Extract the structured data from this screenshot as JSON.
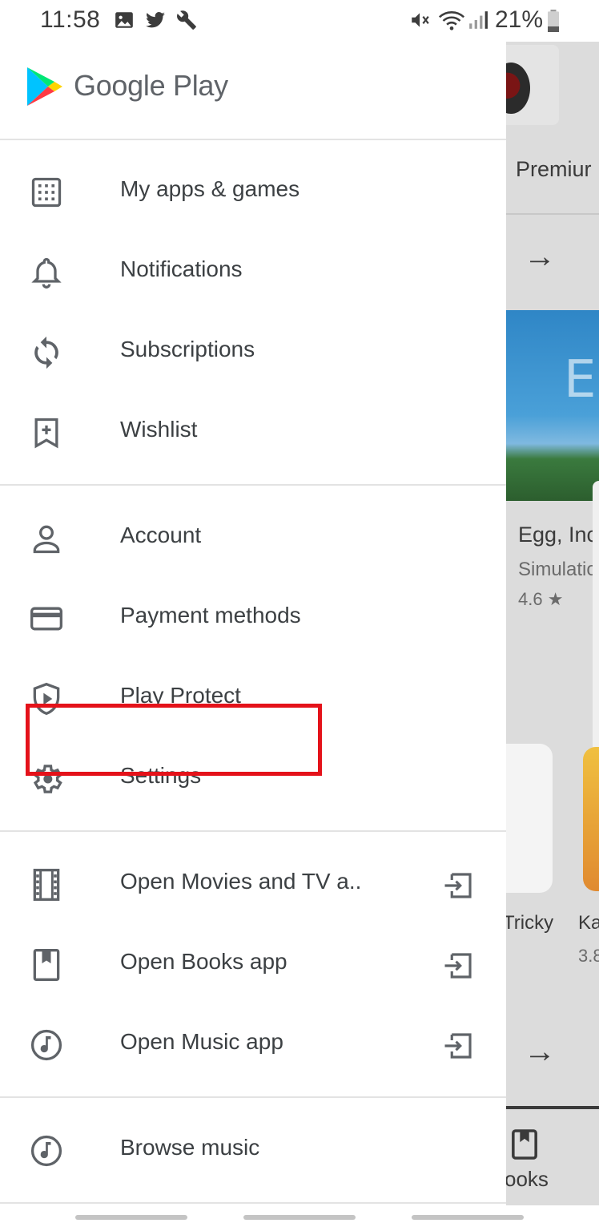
{
  "status_bar": {
    "time": "11:58",
    "battery_percent": "21%",
    "left_icons": [
      "image-icon",
      "twitter-icon",
      "wrench-icon"
    ],
    "right_icons": [
      "mute-icon",
      "wifi-icon",
      "signal-icon",
      "battery-icon"
    ]
  },
  "drawer": {
    "title": "Google Play",
    "sections": [
      {
        "items": [
          {
            "label": "My apps & games",
            "icon": "apps-grid-icon"
          },
          {
            "label": "Notifications",
            "icon": "bell-icon"
          },
          {
            "label": "Subscriptions",
            "icon": "refresh-icon"
          },
          {
            "label": "Wishlist",
            "icon": "bookmark-add-icon"
          }
        ]
      },
      {
        "items": [
          {
            "label": "Account",
            "icon": "person-icon"
          },
          {
            "label": "Payment methods",
            "icon": "credit-card-icon"
          },
          {
            "label": "Play Protect",
            "icon": "shield-play-icon"
          },
          {
            "label": "Settings",
            "icon": "gear-icon",
            "highlighted": true
          }
        ]
      },
      {
        "items": [
          {
            "label": "Open Movies and TV a..",
            "icon": "film-icon",
            "trailing_icon": "open-app-icon"
          },
          {
            "label": "Open Books app",
            "icon": "book-icon",
            "trailing_icon": "open-app-icon"
          },
          {
            "label": "Open Music app",
            "icon": "music-icon",
            "trailing_icon": "open-app-icon"
          }
        ]
      },
      {
        "items": [
          {
            "label": "Browse music",
            "icon": "music-icon"
          }
        ]
      }
    ]
  },
  "background": {
    "tab_label": "Premiur",
    "banner_text": "EG",
    "featured_title": "Egg, Inc",
    "featured_category": "Simulatio",
    "featured_rating": "4.6 ★",
    "app_label_1": "Tricky",
    "app_label_2": "Ka",
    "app_rating_2": "3.8",
    "bottom_nav_label": "ooks"
  },
  "colors": {
    "highlight": "#e4121a",
    "icon": "#5f6368",
    "text": "#3c4043",
    "scrim": "#dcdcdc"
  }
}
